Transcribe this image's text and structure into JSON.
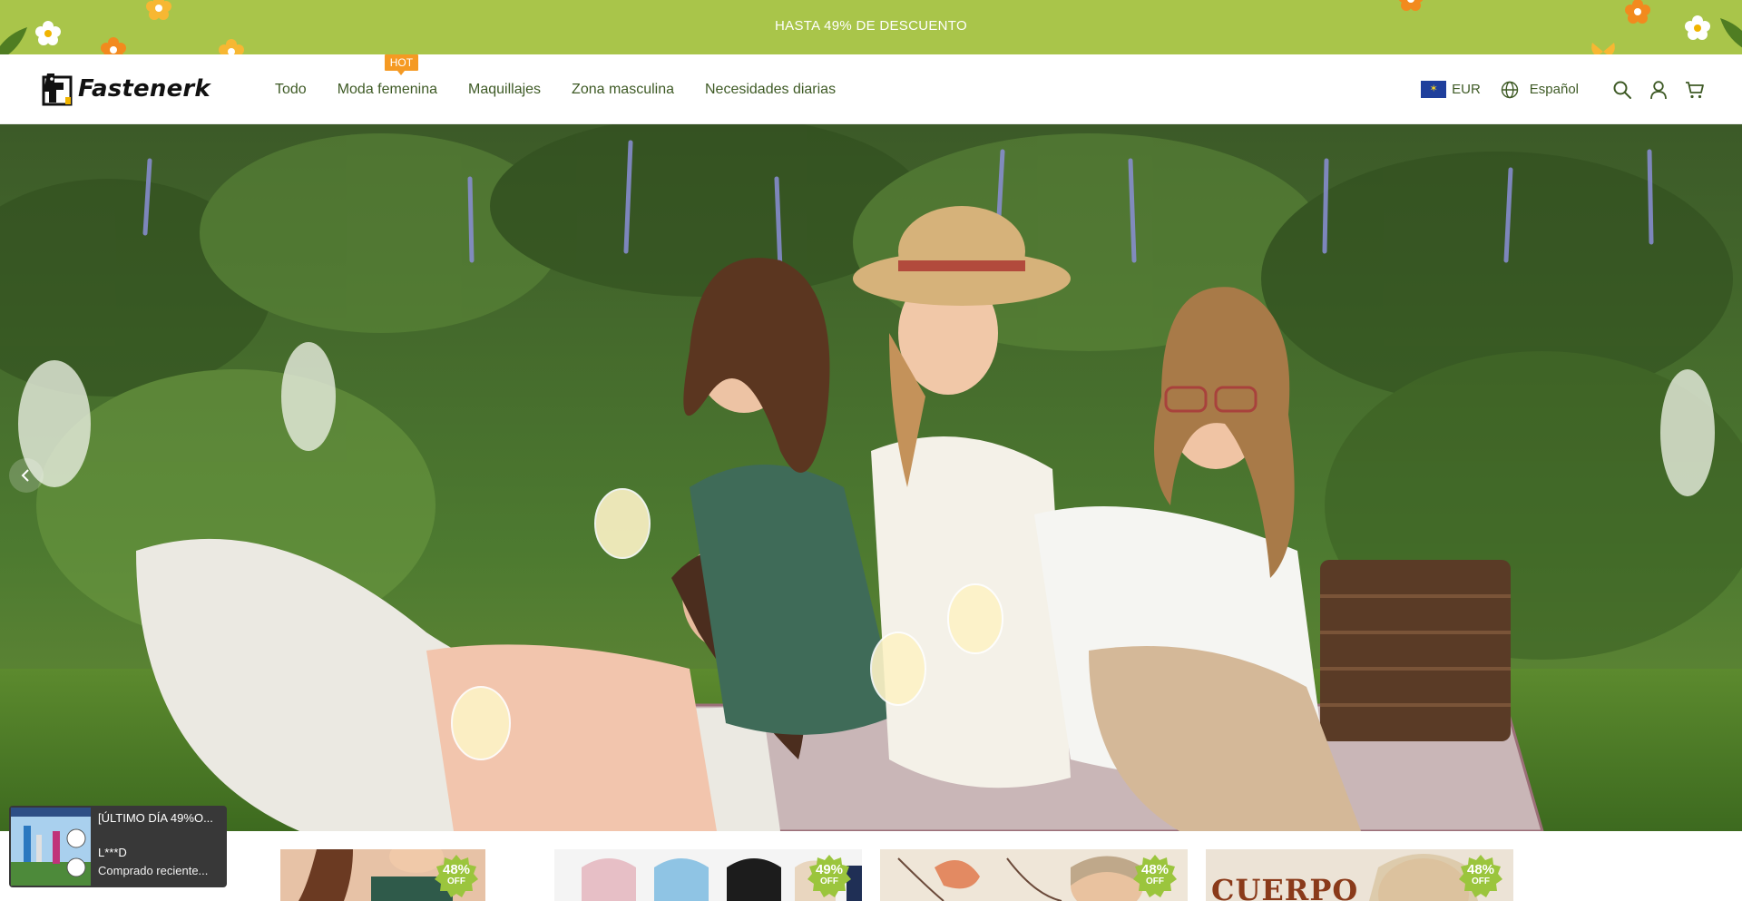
{
  "announcement": {
    "text": "HASTA 49% DE DESCUENTO"
  },
  "brand": {
    "name": "Fastenerk",
    "logo_icon": "dog-logo-icon"
  },
  "nav": {
    "items": [
      {
        "label": "Todo"
      },
      {
        "label": "Moda femenina",
        "badge": "HOT"
      },
      {
        "label": "Maquillajes"
      },
      {
        "label": "Zona masculina"
      },
      {
        "label": "Necesidades diarias"
      }
    ]
  },
  "header": {
    "currency": "EUR",
    "language": "Español",
    "icons": [
      "eu-flag-icon",
      "globe-icon",
      "search-icon",
      "account-icon",
      "cart-icon"
    ]
  },
  "hero": {
    "image": "women-picnic-photo",
    "prev_icon": "chevron-left-icon"
  },
  "products": [
    {
      "discount": "48%",
      "off": "OFF",
      "image": "woman-swimwear-photo"
    },
    {
      "discount": "49%",
      "off": "OFF",
      "image": "bras-colors-photo"
    },
    {
      "discount": "48%",
      "off": "OFF",
      "image": "bra-sketch-photo"
    },
    {
      "discount": "48%",
      "off": "OFF",
      "image": "body-shaper-photo",
      "caption": "CUERPO"
    }
  ],
  "toast": {
    "title": "[ÚLTIMO DÍA 49%O...",
    "user": "L***D",
    "status": "Comprado reciente..."
  },
  "colors": {
    "announce_bg": "#a9c54a",
    "nav_text": "#3e5a25",
    "hot_badge": "#f59a23",
    "discount_badge": "#9bc53d",
    "toast_bg": "#383838"
  }
}
